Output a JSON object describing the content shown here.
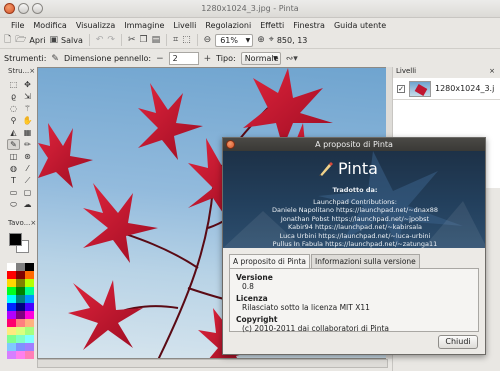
{
  "window": {
    "title": "1280x1024_3.jpg - Pinta"
  },
  "menu": [
    "File",
    "Modifica",
    "Visualizza",
    "Immagine",
    "Livelli",
    "Regolazioni",
    "Effetti",
    "Finestra",
    "Guida utente"
  ],
  "toolbar": {
    "open_label": "Apri",
    "save_label": "Salva",
    "zoom_value": "61%",
    "coords": "850, 13"
  },
  "toolbar2": {
    "tools_label": "Strumenti:",
    "brush_width_label": "Dimensione pennello:",
    "brush_width_value": "2",
    "type_label": "Tipo:",
    "type_value": "Normale"
  },
  "tools_panel": {
    "title": "Stru..."
  },
  "palette_panel": {
    "title": "Tavo..."
  },
  "layers_panel": {
    "title": "Livelli",
    "layers": [
      {
        "name": "1280x1024_3.j"
      }
    ]
  },
  "palette_colors": [
    "#ffffff",
    "#808080",
    "#000000",
    "#ff0000",
    "#800000",
    "#ff6a00",
    "#ffd800",
    "#808000",
    "#b6ff00",
    "#00ff21",
    "#008000",
    "#00ff90",
    "#00ffff",
    "#008080",
    "#0094ff",
    "#0026ff",
    "#000080",
    "#4800ff",
    "#b200ff",
    "#800080",
    "#ff00dc",
    "#ff006e",
    "#ff7f7f",
    "#ffb27f",
    "#ffe97f",
    "#daff7f",
    "#a5ff7f",
    "#7fff8e",
    "#7fffc5",
    "#7fffff",
    "#7fc9ff",
    "#7f92ff",
    "#a17fff",
    "#d67fff",
    "#ff7fed",
    "#ff7fb6"
  ],
  "about_dialog": {
    "title": "A proposito di Pinta",
    "brand": "Pinta",
    "translated_by": "Tradotto da:",
    "credits": [
      "Launchpad Contributions:",
      "Daniele Napolitano https://launchpad.net/~dnax88",
      "Jonathan Pobst https://launchpad.net/~jpobst",
      "Kabir94 https://launchpad.net/~kabirsala",
      "Luca Urbini https://launchpad.net/~luca-urbini",
      "Pullus In Fabula https://launchpad.net/~zatunga11"
    ],
    "tabs": [
      "A proposito di Pinta",
      "Informazioni sulla versione"
    ],
    "version_label": "Versione",
    "version_value": "0.8",
    "license_label": "Licenza",
    "license_value": "Rilasciato sotto la licenza MIT X11",
    "copyright_label": "Copyright",
    "copyright_value": "(c) 2010-2011 dai collaboratori di Pinta",
    "close_label": "Chiudi"
  }
}
